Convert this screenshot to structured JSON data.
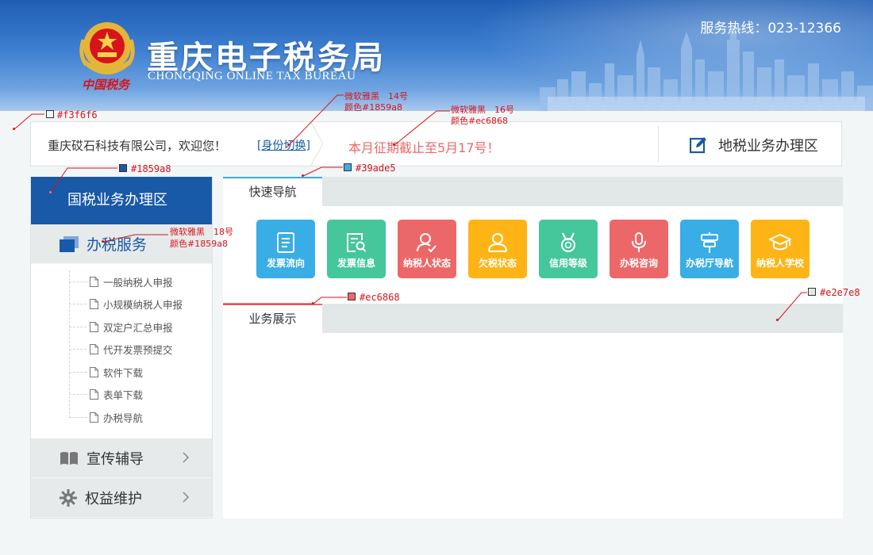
{
  "header": {
    "site_title": "重庆电子税务局",
    "site_subtitle": "CHONGQING ONLINE TAX BUREAU",
    "hotline": "服务热线：023-12366",
    "emblem_caption": "中国税务"
  },
  "welcome_bar": {
    "welcome_text": "重庆砹石科技有限公司，欢迎您！",
    "switch_identity": "[身份切换]",
    "deadline_notice": "本月征期截止至5月17号！",
    "local_tax_zone": "地税业务办理区"
  },
  "sidebar": {
    "head": "国税业务办理区",
    "groups": [
      {
        "label": "办税服务",
        "icon": "window-stack-icon"
      },
      {
        "label": "宣传辅导",
        "icon": "open-book-icon"
      },
      {
        "label": "权益维护",
        "icon": "gear-icon"
      }
    ],
    "sub_items": [
      "一般纳税人申报",
      "小规模纳税人申报",
      "双定户汇总申报",
      "代开发票预提交",
      "软件下载",
      "表单下载",
      "办税导航"
    ]
  },
  "main": {
    "quick_nav_title": "快速导航",
    "business_title": "业务展示",
    "nav_buttons": [
      {
        "label": "发票流向",
        "color": "#39ade5",
        "icon": "document-list-icon"
      },
      {
        "label": "发票信息",
        "color": "#45c69b",
        "icon": "document-search-icon"
      },
      {
        "label": "纳税人状态",
        "color": "#ec6868",
        "icon": "user-check-icon"
      },
      {
        "label": "欠税状态",
        "color": "#ffb416",
        "icon": "user-icon"
      },
      {
        "label": "信用等级",
        "color": "#45c69b",
        "icon": "medal-icon"
      },
      {
        "label": "办税咨询",
        "color": "#ec6868",
        "icon": "microphone-icon"
      },
      {
        "label": "办税厅导航",
        "color": "#39ade5",
        "icon": "signpost-icon"
      },
      {
        "label": "纳税人学校",
        "color": "#ffb416",
        "icon": "graduation-cap-icon"
      }
    ]
  },
  "annotations": {
    "bg_color": "#f3f6f6",
    "link_font": "微软雅黑　14号",
    "link_color": "颜色#1859a8",
    "notice_font": "微软雅黑　16号",
    "notice_color": "颜色#ec6868",
    "sidebar_color": "#1859a8",
    "tab_color": "#39ade5",
    "group_font": "微软雅黑　18号",
    "group_color": "颜色#1859a8",
    "business_tab_color": "#ec6868",
    "tabbar_color": "#e2e7e8"
  },
  "colors": {
    "primary": "#1859a8",
    "accent_blue": "#39ade5",
    "accent_red": "#ec6868",
    "tab_bar": "#e2e7e8",
    "page_bg": "#f3f6f6"
  }
}
